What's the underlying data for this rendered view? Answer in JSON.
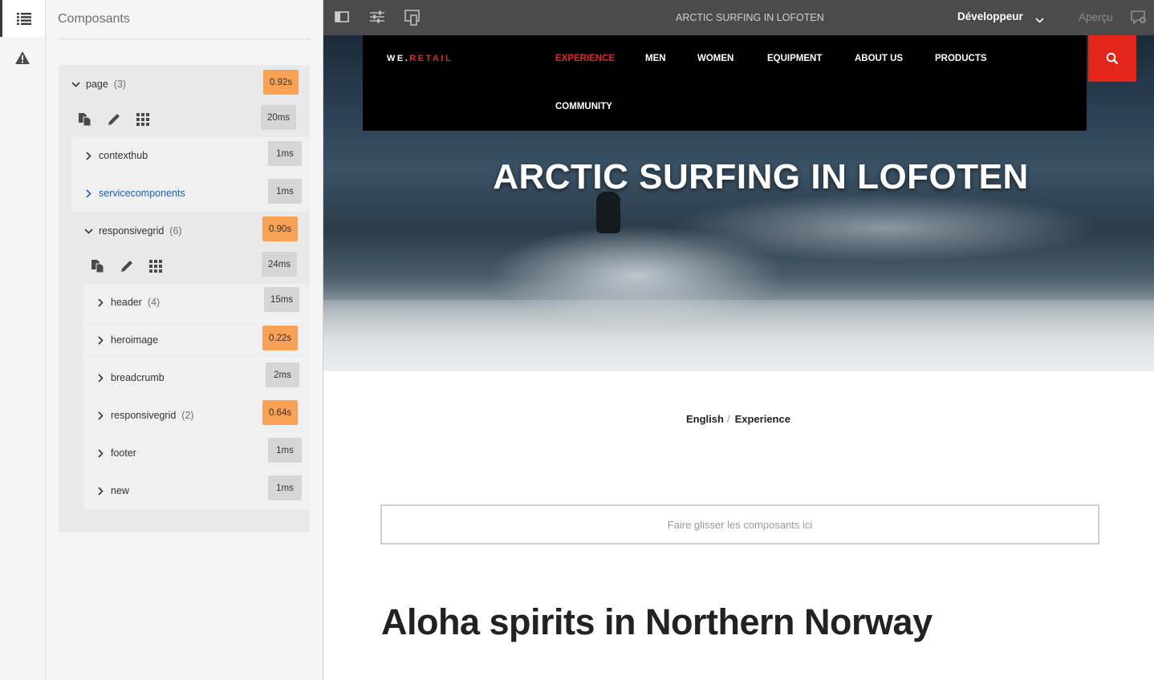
{
  "panel": {
    "title": "Composants",
    "tree": [
      {
        "label": "page",
        "count": "(3)",
        "time": "0.92s",
        "slow": true
      },
      {
        "tools_time": "20ms"
      },
      {
        "label": "contexthub",
        "time": "1ms"
      },
      {
        "label": "servicecomponents",
        "time": "1ms"
      },
      {
        "label": "responsivegrid",
        "count": "(6)",
        "time": "0.90s",
        "slow": true
      },
      {
        "tools_time": "24ms"
      },
      {
        "label": "header",
        "count": "(4)",
        "time": "15ms"
      },
      {
        "label": "heroimage",
        "time": "0.22s",
        "slow": true
      },
      {
        "label": "breadcrumb",
        "time": "2ms"
      },
      {
        "label": "responsivegrid",
        "count": "(2)",
        "time": "0.64s",
        "slow": true
      },
      {
        "label": "footer",
        "time": "1ms"
      },
      {
        "label": "new",
        "time": "1ms"
      }
    ]
  },
  "topbar": {
    "page_title": "ARCTIC SURFING IN LOFOTEN",
    "mode": "Développeur",
    "preview": "Aperçu"
  },
  "site": {
    "logo_prefix": "WE.",
    "logo_accent": "RETAIL",
    "nav": [
      "EXPERIENCE",
      "MEN",
      "WOMEN",
      "EQUIPMENT",
      "ABOUT US",
      "PRODUCTS",
      "COMMUNITY"
    ],
    "hero_title": "ARCTIC SURFING IN LOFOTEN",
    "breadcrumb": [
      "English",
      "Experience"
    ],
    "dropzone": "Faire glisser les composants ici",
    "headline": "Aloha spirits in Northern Norway"
  },
  "colors": {
    "accent_red": "#e4251b",
    "slow_badge": "#f9a256",
    "topbar": "#4b4b4b"
  }
}
